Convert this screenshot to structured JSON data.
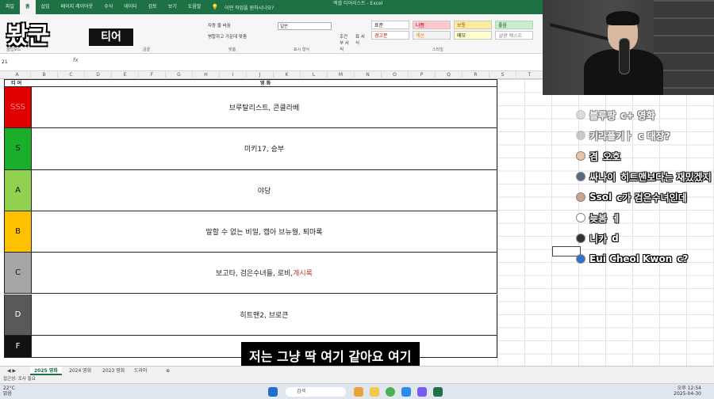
{
  "ribbon_tabs": [
    "파일",
    "홈",
    "삽입",
    "페이지 레이아웃",
    "수식",
    "데이터",
    "검토",
    "보기",
    "도움말"
  ],
  "tell_me": "어떤 작업을 원하시나요?",
  "window_title": "엑셀 티어리스트 - Excel",
  "logo": {
    "text": "봤군",
    "sub": "티어"
  },
  "ribbon": {
    "wrap_text": "자동 줄 바꿈",
    "merge_center": "병합하고 가운데 맞춤",
    "number_format": "일반",
    "conditional": "조건부 서식",
    "table_format": "표 서식",
    "styles": [
      "표준",
      "나쁨",
      "보통",
      "좋음",
      "경고문",
      "계산",
      "메모",
      "설명 텍스트"
    ],
    "group_clipboard": "클립보드",
    "group_font": "글꼴",
    "group_align": "맞춤",
    "group_number": "표시 형식",
    "group_styles": "스타일"
  },
  "name_box": "21",
  "columns": [
    "A",
    "B",
    "C",
    "D",
    "E",
    "F",
    "G",
    "H",
    "I",
    "J",
    "K",
    "L",
    "M",
    "N",
    "O",
    "P",
    "Q",
    "R",
    "S",
    "T",
    "U",
    "V"
  ],
  "table": {
    "tier_header": "티 어",
    "movie_header": "영 화",
    "rows": [
      {
        "tier": "SSS",
        "color": "#e00000",
        "text_color": "#ff8a8a",
        "movies": "브루탈리스트, 콘클라베",
        "highlight": ""
      },
      {
        "tier": "S",
        "color": "#1aae2a",
        "text_color": "#111111",
        "movies": "미키17, 승부",
        "highlight": ""
      },
      {
        "tier": "A",
        "color": "#92d050",
        "text_color": "#111111",
        "movies": "야당",
        "highlight": ""
      },
      {
        "tier": "B",
        "color": "#ffc000",
        "text_color": "#111111",
        "movies": "말할 수 없는 비밀, 캡아 브뉴월, 퇴마록",
        "highlight": ""
      },
      {
        "tier": "C",
        "color": "#a6a6a6",
        "text_color": "#111111",
        "movies": "보고타, 검은수녀들, 로비, ",
        "highlight": "계시록"
      },
      {
        "tier": "D",
        "color": "#595959",
        "text_color": "#ffffff",
        "movies": "히트맨2, 브로큰",
        "highlight": ""
      },
      {
        "tier": "F",
        "color": "#111111",
        "text_color": "#ffffff",
        "movies": "",
        "highlight": ""
      }
    ]
  },
  "chat": [
    {
      "user": "블루팡",
      "msg": "c+ 영화",
      "avatar": "#bbbbbb",
      "faded": true
    },
    {
      "user": "키라플키ㅏ",
      "msg": "c 대장?",
      "avatar": "#999999",
      "faded": true
    },
    {
      "user": "겸",
      "msg": "오호",
      "avatar": "#e8c4a0",
      "faded": false
    },
    {
      "user": "싸나이",
      "msg": "히트맨보다는 재밌겠지",
      "avatar": "#5a6a80",
      "faded": false
    },
    {
      "user": "Ssol",
      "msg": "c가 검은수녀인데",
      "avatar": "#c9a48a",
      "faded": false
    },
    {
      "user": "늦봄",
      "msg": "ㅔ",
      "avatar": "#ffffff",
      "faded": false
    },
    {
      "user": "니카",
      "msg": "d",
      "avatar": "#333333",
      "faded": false
    },
    {
      "user": "Eui Cheol Kwon",
      "msg": "c?",
      "avatar": "#2f6fd0",
      "faded": false
    }
  ],
  "subtitle": "저는 그냥 딱 여기 같아요 여기",
  "sheet_tabs": [
    "2025 영화",
    "2024 영화",
    "2023 영화",
    "드라마"
  ],
  "status": "접근성: 조사 필요",
  "taskbar": {
    "weather_temp": "22°C",
    "weather_desc": "맑음",
    "search": "검색",
    "time": "오후 12:54",
    "date": "2025-04-30"
  }
}
